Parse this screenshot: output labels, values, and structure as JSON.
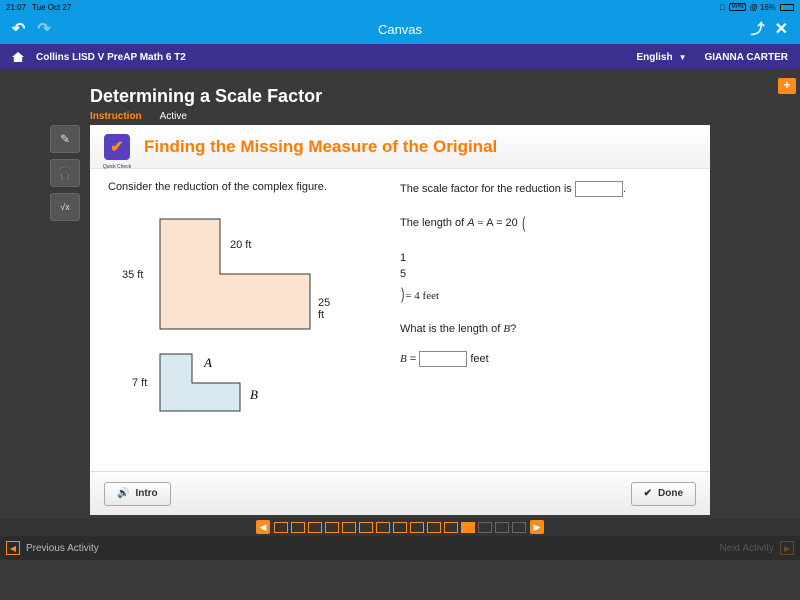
{
  "status": {
    "time": "21:07",
    "date": "Tue Oct 27",
    "vpn": "VPN",
    "battery": "16%"
  },
  "canvas": {
    "title": "Canvas"
  },
  "course": {
    "name": "Collins LISD V PreAP Math 6 T2",
    "language": "English",
    "user": "GIANNA CARTER"
  },
  "lesson": {
    "title": "Determining a Scale Factor",
    "tab_instruction": "Instruction",
    "tab_active": "Active"
  },
  "card": {
    "quickcheck": "Quick Check",
    "title": "Finding the Missing Measure of the Original",
    "prompt": "Consider the reduction of the complex figure.",
    "large_fig": {
      "top": "20 ft",
      "left": "35 ft",
      "right": "25 ft"
    },
    "small_fig": {
      "left": "7 ft",
      "A": "A",
      "B": "B"
    },
    "q1_pre": "The scale factor for the reduction is ",
    "q2_pre": "The length of ",
    "q2_eq_a": "A = 20",
    "q2_frac_n": "1",
    "q2_frac_d": "5",
    "q2_eq_b": "= 4 feet",
    "q3": "What is the length of B?",
    "q4_pre": "B = ",
    "q4_post": " feet",
    "intro": "Intro",
    "done": "Done"
  },
  "nav": {
    "prev": "Previous Activity",
    "next": "Next Activity"
  },
  "progress": {
    "total": 15,
    "current": 12
  }
}
